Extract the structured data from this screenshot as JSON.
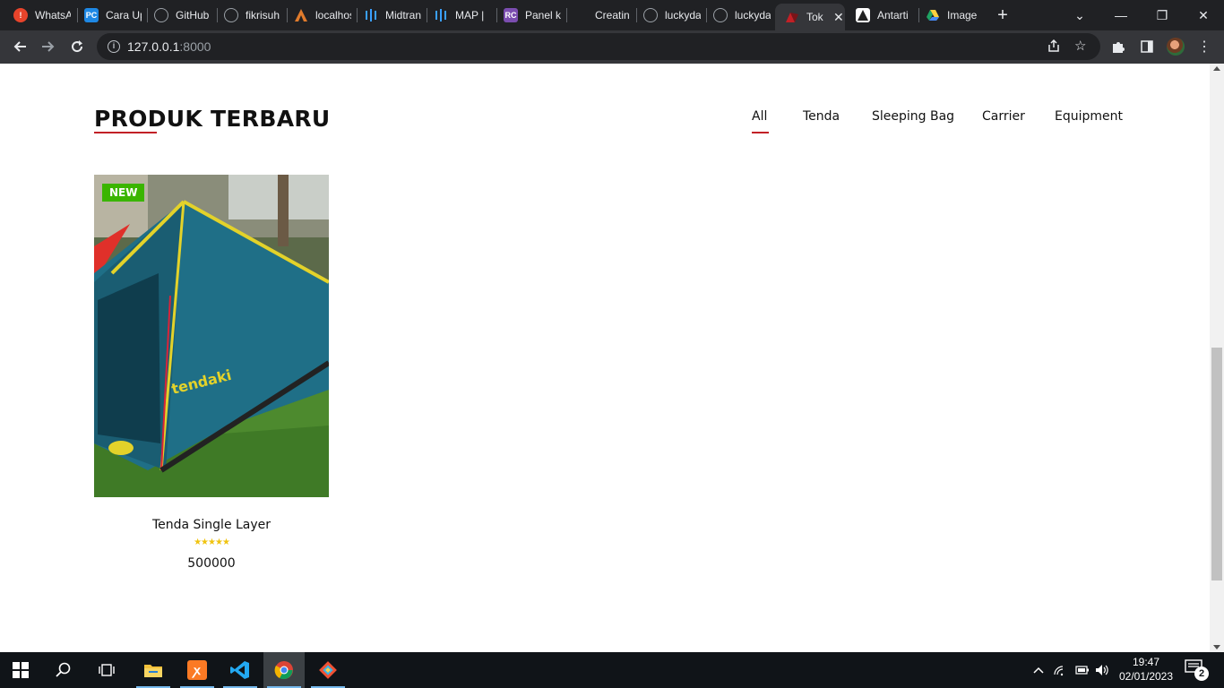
{
  "browser": {
    "tabs": [
      {
        "label": "WhatsApp",
        "icon": "whatsapp-icon",
        "color": "#e8442b"
      },
      {
        "label": "Cara Upload",
        "icon": "pc-icon",
        "color": "#1e88e5"
      },
      {
        "label": "GitHub",
        "icon": "github-icon",
        "color": "#2b2b2b"
      },
      {
        "label": "fikrisuh",
        "icon": "github-icon",
        "color": "#2b2b2b"
      },
      {
        "label": "localhost",
        "icon": "xampp-icon",
        "color": "#b35b2b"
      },
      {
        "label": "Midtrans",
        "icon": "midtrans-icon",
        "color": "#0a5fb4"
      },
      {
        "label": "MAP | ",
        "icon": "midtrans-icon",
        "color": "#0a5fb4"
      },
      {
        "label": "Panel k",
        "icon": "rc-icon",
        "color": "#7b4db0"
      },
      {
        "label": "Creatin",
        "icon": "blank-icon",
        "color": "#202124"
      },
      {
        "label": "luckyda",
        "icon": "github-icon",
        "color": "#2b2b2b"
      },
      {
        "label": "luckyda",
        "icon": "github-icon",
        "color": "#2b2b2b"
      },
      {
        "label": "Tok",
        "icon": "tent-icon",
        "color": "#c22026"
      },
      {
        "label": "Antarti",
        "icon": "antartika-icon",
        "color": "#333333"
      },
      {
        "label": "Image",
        "icon": "google-drive-icon",
        "color": "#1fa463"
      }
    ],
    "url_host": "127.0.0.1",
    "url_port": ":8000"
  },
  "page": {
    "section_title": "PRODUK TERBARU",
    "filters": [
      "All",
      "Tenda",
      "Sleeping Bag",
      "Carrier",
      "Equipment"
    ],
    "active_filter": "All",
    "accent_color": "#c22026",
    "products": [
      {
        "badge": "NEW",
        "badge_color": "#3ab500",
        "name": "Tenda Single Layer",
        "rating": 5,
        "stars": "★★★★★",
        "price": "500000",
        "image_text": "tendaki"
      }
    ]
  },
  "taskbar": {
    "time": "19:47",
    "date": "02/01/2023",
    "notification_count": "2",
    "apps": [
      "file-explorer-icon",
      "xampp-icon",
      "vscode-icon",
      "chrome-icon",
      "git-icon"
    ]
  }
}
